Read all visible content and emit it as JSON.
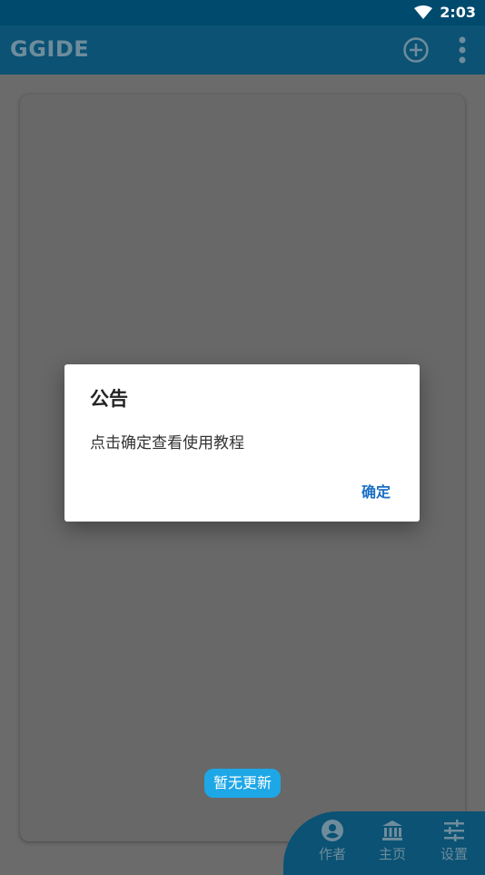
{
  "status": {
    "time": "2:03"
  },
  "appbar": {
    "title": "GGIDE",
    "add_icon": "add-circle-icon",
    "more_icon": "more-vert-icon"
  },
  "toast": {
    "text": "暂无更新"
  },
  "dialog": {
    "title": "公告",
    "message": "点击确定查看使用教程",
    "ok_label": "确定"
  },
  "bottom_nav": {
    "items": [
      {
        "label": "作者",
        "icon": "account-circle-icon"
      },
      {
        "label": "主页",
        "icon": "bank-icon"
      },
      {
        "label": "设置",
        "icon": "tune-icon"
      }
    ]
  },
  "colors": {
    "primary_dark": "#004a6e",
    "primary": "#0b5274",
    "accent": "#1a6fc4",
    "toast": "#1ea7e6"
  }
}
